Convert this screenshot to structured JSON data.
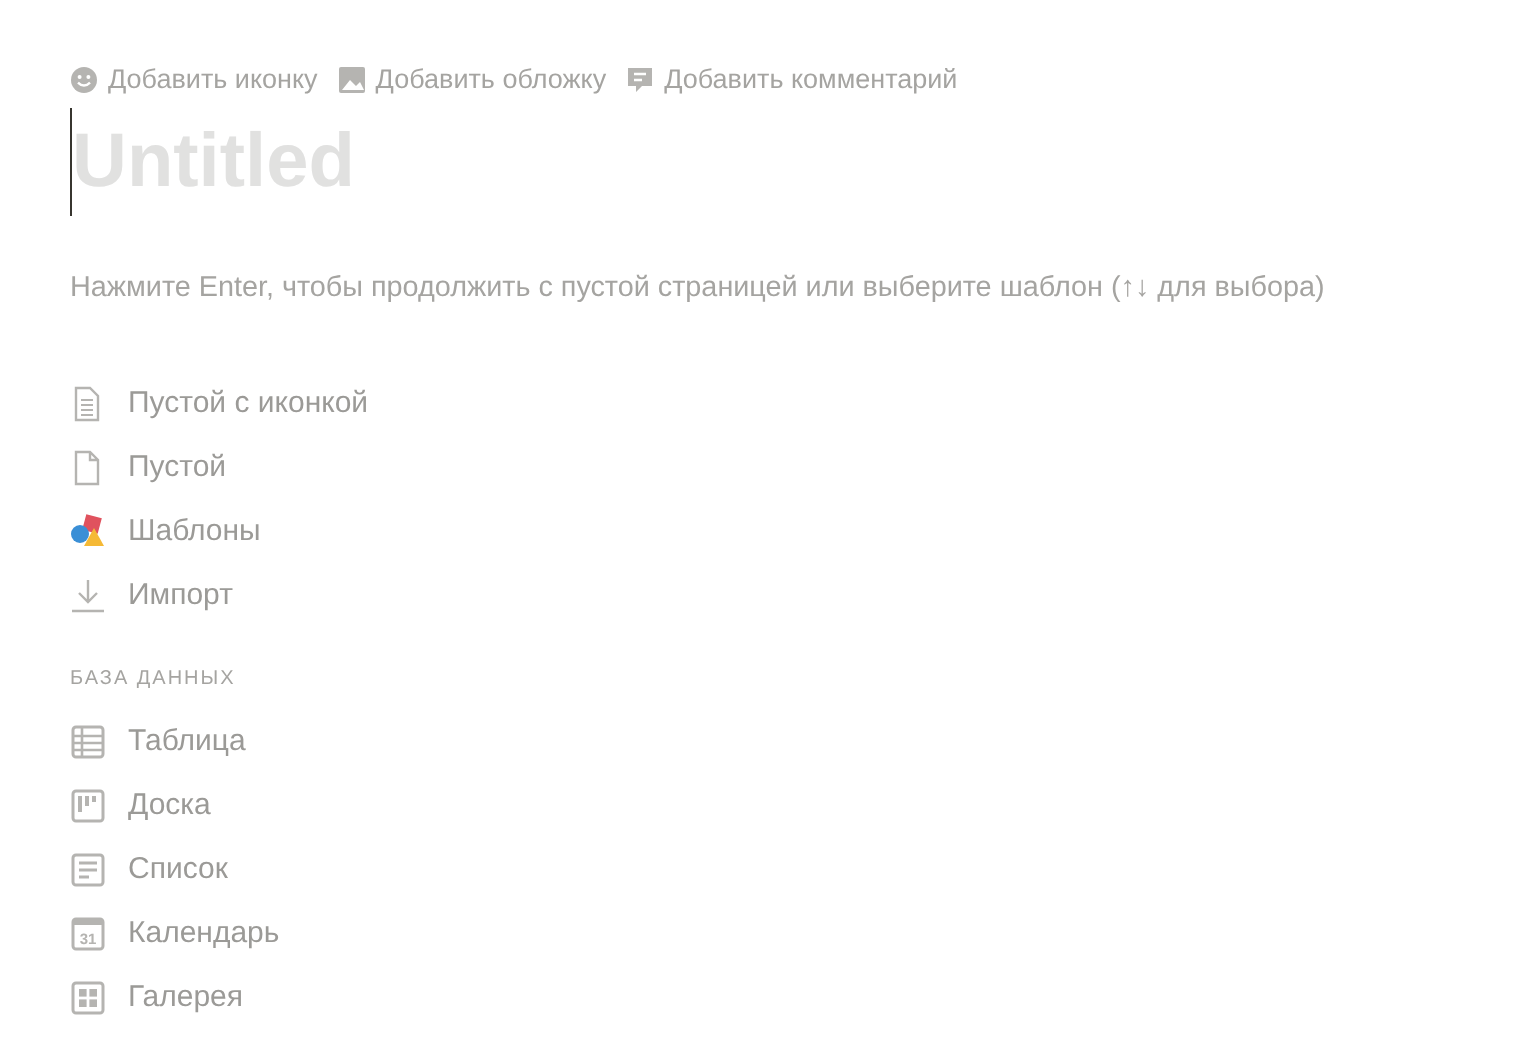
{
  "page_actions": [
    {
      "kind": "icon",
      "label": "Добавить иконку"
    },
    {
      "kind": "cover",
      "label": "Добавить обложку"
    },
    {
      "kind": "comment",
      "label": "Добавить комментарий"
    }
  ],
  "title": {
    "placeholder": "Untitled"
  },
  "hint": "Нажмите Enter, чтобы продолжить с пустой страницей или выберите шаблон (↑↓ для выбора)",
  "options": [
    {
      "kind": "page-lines",
      "label": "Пустой с иконкой"
    },
    {
      "kind": "page",
      "label": "Пустой"
    },
    {
      "kind": "shapes",
      "label": "Шаблоны"
    },
    {
      "kind": "import",
      "label": "Импорт"
    }
  ],
  "database": {
    "heading": "БАЗА ДАННЫХ",
    "items": [
      {
        "kind": "table",
        "label": "Таблица"
      },
      {
        "kind": "board",
        "label": "Доска"
      },
      {
        "kind": "list",
        "label": "Список"
      },
      {
        "kind": "calendar",
        "label": "Календарь",
        "icon_text": "31"
      },
      {
        "kind": "gallery",
        "label": "Галерея"
      }
    ]
  }
}
